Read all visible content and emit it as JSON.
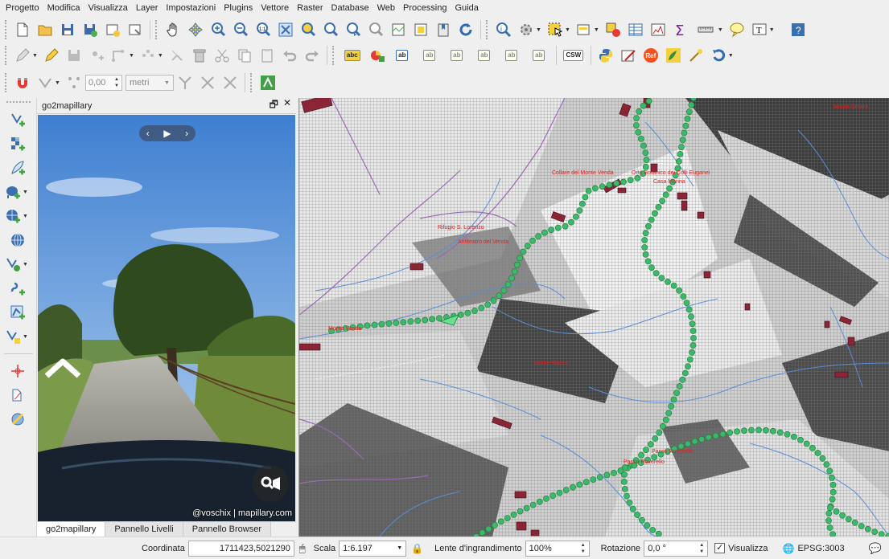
{
  "menu": [
    "Progetto",
    "Modifica",
    "Visualizza",
    "Layer",
    "Impostazioni",
    "Plugins",
    "Vettore",
    "Raster",
    "Database",
    "Web",
    "Processing",
    "Guida"
  ],
  "toolbar3": {
    "tolerance_value": "0,00",
    "unit": "metri"
  },
  "toolbar2": {
    "label_abc": "abc",
    "csw": "CSW",
    "ref": "Ref"
  },
  "dock": {
    "title": "go2mapillary",
    "attribution": "@voschix | mapillary.com",
    "tabs": [
      "go2mapillary",
      "Pannello Livelli",
      "Pannello Browser"
    ]
  },
  "map_labels": [
    "Monte Orsara",
    "Collare del Monte Venda",
    "Orto Botanico dei Colli Euganei",
    "Casa Marina",
    "Rifugio S. Lorenzo",
    "Anfiteatro del Venda",
    "Monte Venda",
    "Monte Manzo",
    "Passo Roverello",
    "Passo Roverello"
  ],
  "status": {
    "coord_label": "Coordinata",
    "coord_value": "1711423,5021290",
    "scale_label": "Scala",
    "scale_value": "1:6.197",
    "magnifier_label": "Lente d'ingrandimento",
    "magnifier_value": "100%",
    "rotation_label": "Rotazione",
    "rotation_value": "0,0 °",
    "render_label": "Visualizza",
    "crs": "EPSG:3003"
  }
}
